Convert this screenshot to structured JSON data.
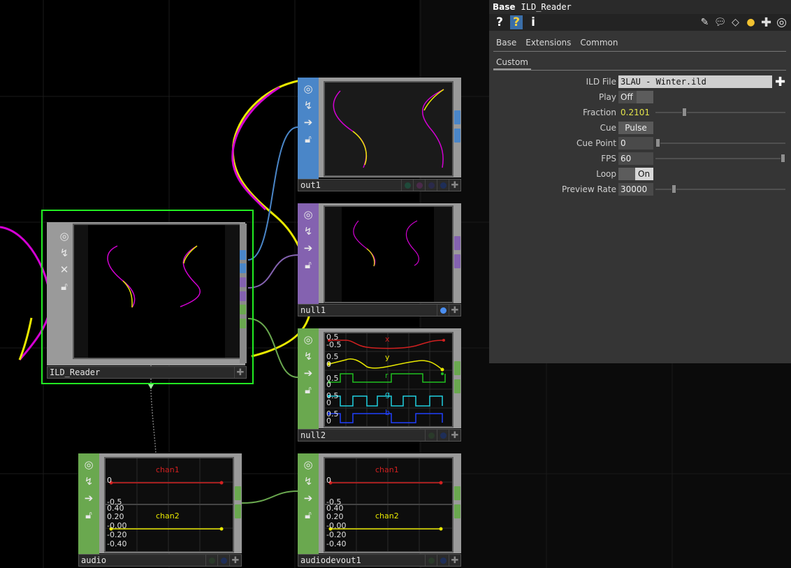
{
  "panel": {
    "op_type": "Base",
    "op_name": "ILD_Reader",
    "tool_help": "?",
    "tool_help_python": "?",
    "tool_info": "i",
    "tabs": [
      "Base",
      "Extensions",
      "Common"
    ],
    "active_tab": "Custom",
    "params": {
      "ild_file": {
        "label": "ILD File",
        "value": "3LAU - Winter.ild"
      },
      "play": {
        "label": "Play",
        "value": "Off"
      },
      "fraction": {
        "label": "Fraction",
        "value": "0.2101"
      },
      "cue": {
        "label": "Cue",
        "value": "Pulse"
      },
      "cue_point": {
        "label": "Cue Point",
        "value": "0"
      },
      "fps": {
        "label": "FPS",
        "value": "60"
      },
      "loop": {
        "label": "Loop",
        "value": "On"
      },
      "preview_rate": {
        "label": "Preview Rate",
        "value": "30000"
      }
    },
    "value_color": "#e4e44a"
  },
  "nodes": {
    "ild_reader": {
      "name": "ILD_Reader",
      "color": "#9a9a9a",
      "selected_color": "#22ee22"
    },
    "out1": {
      "name": "out1",
      "color": "#4a86c8"
    },
    "null1": {
      "name": "null1",
      "color": "#8462b0"
    },
    "null2": {
      "name": "null2",
      "color": "#6aa84f",
      "channels": [
        "x",
        "y",
        "r",
        "g",
        "b"
      ],
      "ticks": [
        "0.5",
        "-0.5",
        "0.5",
        "0",
        "0.5",
        "0",
        "0.5",
        "0",
        "0.5",
        "0"
      ]
    },
    "audio": {
      "name": "audio",
      "color": "#6aa84f",
      "channels": [
        "chan1",
        "chan2"
      ],
      "ticks_top": [
        "0.5",
        "0",
        "-0.5"
      ],
      "ticks_bottom": [
        "0.40",
        "0.20",
        "-0.00",
        "-0.20",
        "-0.40"
      ]
    },
    "audiodevout1": {
      "name": "audiodevout1",
      "color": "#6aa84f",
      "channels": [
        "chan1",
        "chan2"
      ],
      "ticks_top": [
        "0.5",
        "0",
        "-0.5"
      ],
      "ticks_bottom": [
        "0.40",
        "0.20",
        "-0.00",
        "-0.20",
        "-0.40"
      ]
    }
  },
  "icons": {
    "viewer_active": "target-icon",
    "bypass": "lightning-icon",
    "export": "arrow-right-icon",
    "lock": "lock-icon",
    "clone": "close-icon",
    "add": "plus-icon"
  },
  "colors": {
    "magenta": "#d400d4",
    "yellow": "#e8e800",
    "red_channel": "#d02020",
    "green_channel": "#20c020",
    "cyan_channel": "#20d0e0",
    "blue_channel": "#2040ff"
  }
}
